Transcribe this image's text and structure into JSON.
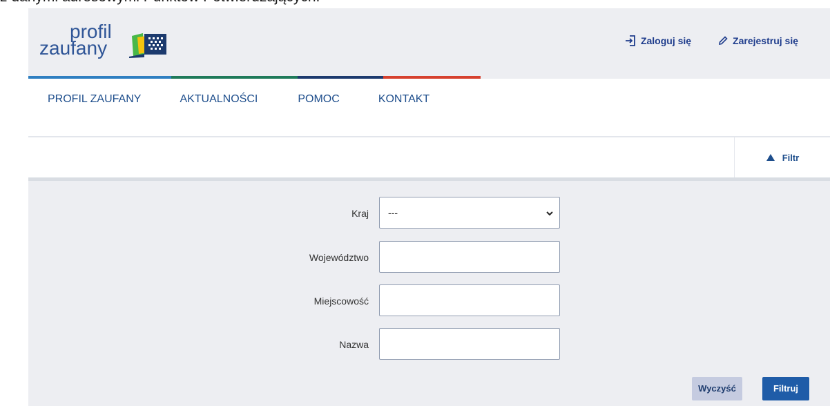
{
  "intro_text": "z danymi adresowymi Punktów Potwierdzających.",
  "logo": {
    "line1": "profil",
    "line2": "zaufany"
  },
  "header_links": {
    "login": "Zaloguj się",
    "register": "Zarejestruj się"
  },
  "nav": [
    "PROFIL ZAUFANY",
    "AKTUALNOŚCI",
    "POMOC",
    "KONTAKT"
  ],
  "filter_toggle": "Filtr",
  "form": {
    "country": {
      "label": "Kraj",
      "value": "---"
    },
    "province": {
      "label": "Województwo",
      "value": ""
    },
    "city": {
      "label": "Miejscowość",
      "value": ""
    },
    "name": {
      "label": "Nazwa",
      "value": ""
    }
  },
  "buttons": {
    "clear": "Wyczyść",
    "filter": "Filtruj"
  },
  "colors": {
    "stripe_blue": "#2f7fc1",
    "stripe_green": "#1f7a5a",
    "stripe_navy": "#1c3a6e",
    "stripe_red": "#d6412f",
    "accent": "#1f5ca8"
  }
}
